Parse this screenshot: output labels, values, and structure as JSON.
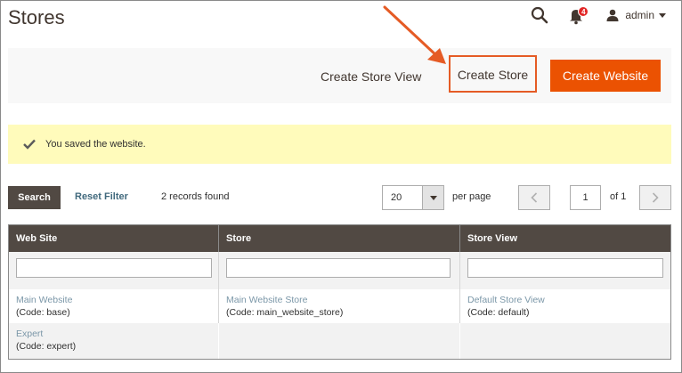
{
  "page": {
    "title": "Stores"
  },
  "header": {
    "notifications_count": "4",
    "user": "admin"
  },
  "actions": {
    "create_store_view": "Create Store View",
    "create_store": "Create Store",
    "create_website": "Create Website"
  },
  "message": {
    "text": "You saved the website."
  },
  "grid_controls": {
    "search": "Search",
    "reset_filter": "Reset Filter",
    "records_found": "2 records found",
    "per_page_value": "20",
    "per_page_label": "per page",
    "current_page": "1",
    "total_pages": "of 1"
  },
  "grid": {
    "columns": [
      "Web Site",
      "Store",
      "Store View"
    ],
    "rows": [
      {
        "website": "Main Website",
        "website_code": "(Code: base)",
        "store": "Main Website Store",
        "store_code": "(Code: main_website_store)",
        "store_view": "Default Store View",
        "store_view_code": "(Code: default)"
      },
      {
        "website": "Expert",
        "website_code": "(Code: expert)",
        "store": "",
        "store_code": "",
        "store_view": "",
        "store_view_code": ""
      }
    ]
  },
  "colors": {
    "accent": "#eb5202",
    "annotation": "#e55b25",
    "header_dark": "#514943",
    "message_bg": "#fffbbb",
    "link": "#7b97a8"
  },
  "icons": [
    "search-icon",
    "bell-icon",
    "user-icon",
    "checkmark-icon",
    "chevron-left-icon",
    "chevron-right-icon"
  ]
}
